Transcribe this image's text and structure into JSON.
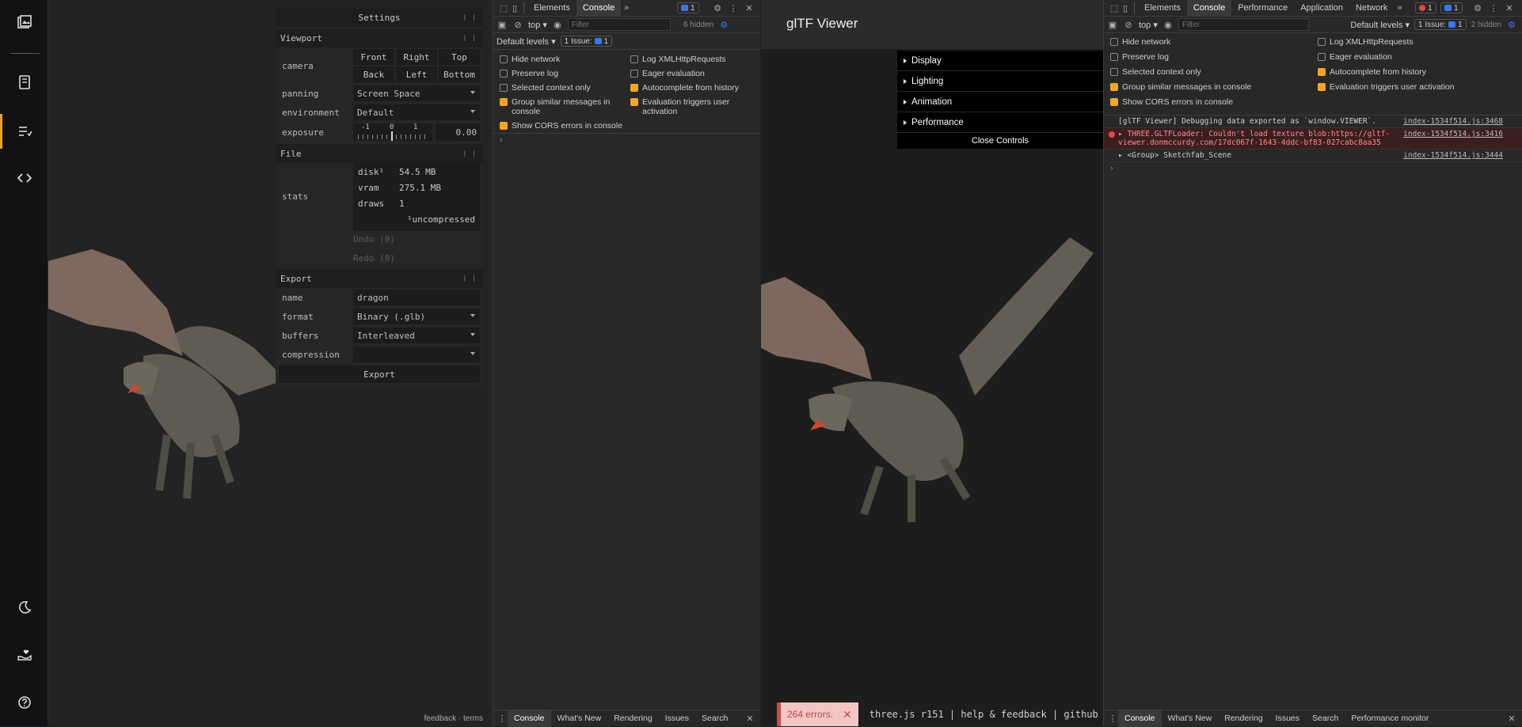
{
  "rail": {
    "icons": [
      "gallery-icon",
      "book-icon",
      "checklist-icon",
      "code-icon",
      "moon-icon",
      "donate-icon",
      "help-icon"
    ]
  },
  "settings": {
    "title": "Settings",
    "viewport": {
      "heading": "Viewport",
      "camera_label": "camera",
      "camera_buttons": [
        "Front",
        "Right",
        "Top",
        "Back",
        "Left",
        "Bottom"
      ],
      "panning_label": "panning",
      "panning_value": "Screen Space",
      "environment_label": "environment",
      "environment_value": "Default",
      "exposure_label": "exposure",
      "exposure_ticks": [
        "-1",
        "0",
        "1"
      ],
      "exposure_value": "0.00"
    },
    "file": {
      "heading": "File",
      "stats_label": "stats",
      "disk_label": "disk¹",
      "disk_value": "54.5 MB",
      "vram_label": "vram",
      "vram_value": "275.1 MB",
      "draws_label": "draws",
      "draws_value": "1",
      "uncompressed_note": "¹uncompressed",
      "undo": "Undo (0)",
      "redo": "Redo (0)"
    },
    "export": {
      "heading": "Export",
      "name_label": "name",
      "name_value": "dragon",
      "format_label": "format",
      "format_value": "Binary (.glb)",
      "buffers_label": "buffers",
      "buffers_value": "Interleaved",
      "compression_label": "compression",
      "compression_value": "",
      "export_button": "Export"
    }
  },
  "vp1_footer": {
    "feedback": "feedback",
    "sep": "·",
    "terms": "terms"
  },
  "devtools1": {
    "tabs": [
      "Elements",
      "Console"
    ],
    "more": "»",
    "issues_badge": "1",
    "context": "top",
    "filter_placeholder": "Filter",
    "hidden": "6 hidden",
    "levels": "Default levels",
    "issue_label": "1 Issue:",
    "issue_count": "1",
    "settings_left": [
      {
        "label": "Hide network",
        "on": false
      },
      {
        "label": "Preserve log",
        "on": false
      },
      {
        "label": "Selected context only",
        "on": false
      },
      {
        "label": "Group similar messages in console",
        "on": true
      },
      {
        "label": "Show CORS errors in console",
        "on": true
      }
    ],
    "settings_right": [
      {
        "label": "Log XMLHttpRequests",
        "on": false
      },
      {
        "label": "Eager evaluation",
        "on": false
      },
      {
        "label": "Autocomplete from history",
        "on": true
      },
      {
        "label": "Evaluation triggers user activation",
        "on": true
      }
    ],
    "prompt": "›",
    "bottom_tabs": [
      "Console",
      "What's New",
      "Rendering",
      "Issues",
      "Search"
    ]
  },
  "viewer2": {
    "title": "glTF Viewer",
    "folders": [
      "Display",
      "Lighting",
      "Animation",
      "Performance"
    ],
    "close_controls": "Close Controls",
    "errors_toast": "264 errors.",
    "footer": "three.js r151 | help & feedback | github"
  },
  "devtools2": {
    "tabs": [
      "Elements",
      "Console",
      "Performance",
      "Application",
      "Network"
    ],
    "more": "»",
    "error_count": "1",
    "msg_count": "1",
    "context": "top",
    "filter_placeholder": "Filter",
    "levels": "Default levels",
    "issue_label": "1 Issue:",
    "issue_count": "1",
    "hidden": "2 hidden",
    "settings_left": [
      {
        "label": "Hide network",
        "on": false
      },
      {
        "label": "Preserve log",
        "on": false
      },
      {
        "label": "Selected context only",
        "on": false
      },
      {
        "label": "Group similar messages in console",
        "on": true
      },
      {
        "label": "Show CORS errors in console",
        "on": true
      }
    ],
    "settings_right": [
      {
        "label": "Log XMLHttpRequests",
        "on": false
      },
      {
        "label": "Eager evaluation",
        "on": false
      },
      {
        "label": "Autocomplete from history",
        "on": true
      },
      {
        "label": "Evaluation triggers user activation",
        "on": true
      }
    ],
    "logs": [
      {
        "text": "[glTF Viewer] Debugging data exported as `window.VIEWER`.",
        "src": "index-1534f514.js:3468",
        "level": "info"
      },
      {
        "text": "▸ THREE.GLTFLoader: Couldn't load texture blob:https://gltf-viewer.donmccurdy.com/17dc067f-1643-4ddc-bf83-027cabc8aa35",
        "src": "index-1534f514.js:3416",
        "level": "error"
      },
      {
        "text": "▸ <Group> Sketchfab_Scene",
        "src": "index-1534f514.js:3444",
        "level": "info"
      }
    ],
    "prompt": "›",
    "bottom_tabs": [
      "Console",
      "What's New",
      "Rendering",
      "Issues",
      "Search",
      "Performance monitor"
    ]
  }
}
